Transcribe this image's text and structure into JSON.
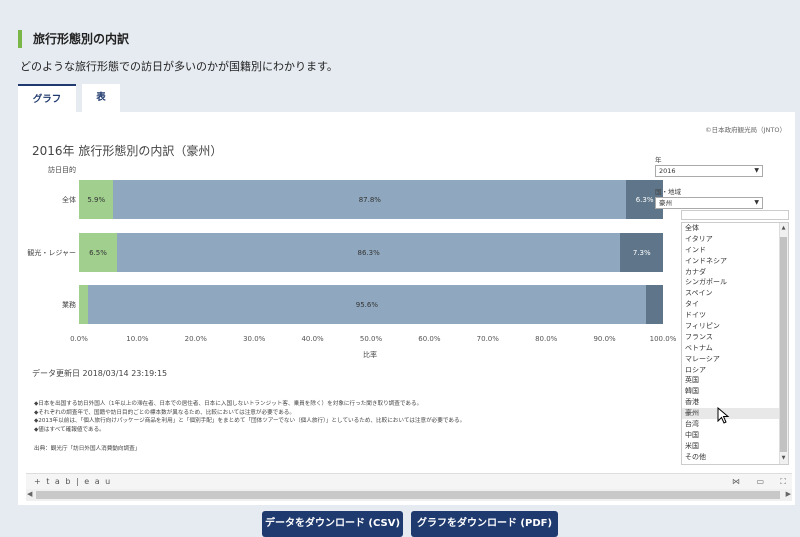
{
  "section": {
    "title": "旅行形態別の内訳",
    "description": "どのような旅行形態での訪日が多いのかが国籍別にわかります。"
  },
  "tabs": [
    {
      "label": "グラフ",
      "active": true
    },
    {
      "label": "表",
      "active": false
    }
  ],
  "viz": {
    "copyright": "©日本政府観光局（JNTO）",
    "updated": "データ更新日 2018/03/14 23:19:15",
    "notes": [
      "◆日本を出国する訪日外国人（1年以上の滞在者、日本での居住者、日本に入国しないトランジット客、乗員を除く）を対象に行った聞き取り調査である。",
      "◆それぞれの調査年で、国籍や訪日目的ごとの標本数が異なるため、比較においては注意が必要である。",
      "◆2013年以前は、「個人旅行向けパッケージ商品を利用」と「個別手配」をまとめて「団体ツアーでない（個人旅行）」としているため、比較においては注意が必要である。",
      "◆値はすべて確報値である。"
    ],
    "source": "出典：観光庁「訪日外国人消費動向調査」"
  },
  "filters": {
    "year_label": "年",
    "year_value": "2016",
    "country_label": "国・地域",
    "country_value": "豪州",
    "country_options": [
      "全体",
      "イタリア",
      "インド",
      "インドネシア",
      "カナダ",
      "シンガポール",
      "スペイン",
      "タイ",
      "ドイツ",
      "フィリピン",
      "フランス",
      "ベトナム",
      "マレーシア",
      "ロシア",
      "英国",
      "韓国",
      "香港",
      "豪州",
      "台湾",
      "中国",
      "米国",
      "その他"
    ],
    "hovered_option": "豪州"
  },
  "toolbar": {
    "logo": "+ t a b | e a u"
  },
  "buttons": {
    "csv": "データをダウンロード (CSV)",
    "pdf": "グラフをダウンロード (PDF)"
  },
  "colors": {
    "seg_a": "#a0cf8e",
    "seg_b": "#8fa8bf",
    "seg_c": "#5f7589",
    "accent": "#1f3a6e"
  },
  "chart_data": {
    "type": "bar",
    "orientation": "horizontal-stacked",
    "title": "2016年 旅行形態別の内訳（豪州）",
    "ylabel": "訪日目的",
    "xlabel": "比率",
    "categories": [
      "全体",
      "観光・レジャー",
      "業務"
    ],
    "series": [
      {
        "values": [
          5.9,
          6.5,
          1.5
        ],
        "labels": [
          "5.9%",
          "6.5%",
          ""
        ],
        "color": "#a0cf8e"
      },
      {
        "values": [
          87.8,
          86.3,
          95.6
        ],
        "labels": [
          "87.8%",
          "86.3%",
          "95.6%"
        ],
        "color": "#8fa8bf"
      },
      {
        "values": [
          6.3,
          7.3,
          2.9
        ],
        "labels": [
          "6.3%",
          "7.3%",
          ""
        ],
        "color": "#5f7589"
      }
    ],
    "xticks": [
      "0.0%",
      "10.0%",
      "20.0%",
      "30.0%",
      "40.0%",
      "50.0%",
      "60.0%",
      "70.0%",
      "80.0%",
      "90.0%",
      "100.0%"
    ],
    "xlim": [
      0,
      100
    ]
  }
}
